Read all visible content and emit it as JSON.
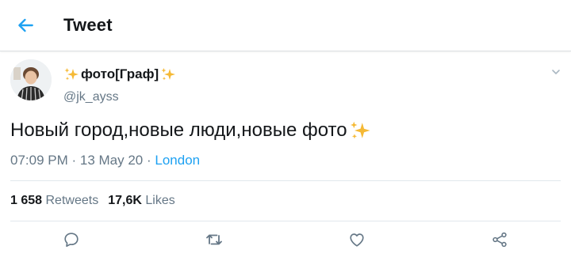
{
  "header": {
    "title": "Tweet",
    "back_icon": "arrow-left-icon"
  },
  "author": {
    "display_name": "фото[Граф]",
    "handle": "@jk_ayss",
    "name_emoji": "sparkles-icon"
  },
  "tweet": {
    "text": "Новый город,новые люди,новые фото",
    "text_emoji": "sparkles-icon",
    "time": "07:09 PM",
    "date": "13 May 20",
    "location": "London",
    "separator": " · "
  },
  "stats": {
    "retweets_count": "1 658",
    "retweets_label": "Retweets",
    "likes_count": "17,6K",
    "likes_label": "Likes"
  },
  "actions": [
    "reply-icon",
    "retweet-icon",
    "like-icon",
    "share-icon"
  ],
  "colors": {
    "accent": "#1da1f2",
    "text": "#14171a",
    "muted": "#657786",
    "icon": "#657786",
    "divider": "#e1e8ed",
    "sparkle": "#f5b935"
  }
}
